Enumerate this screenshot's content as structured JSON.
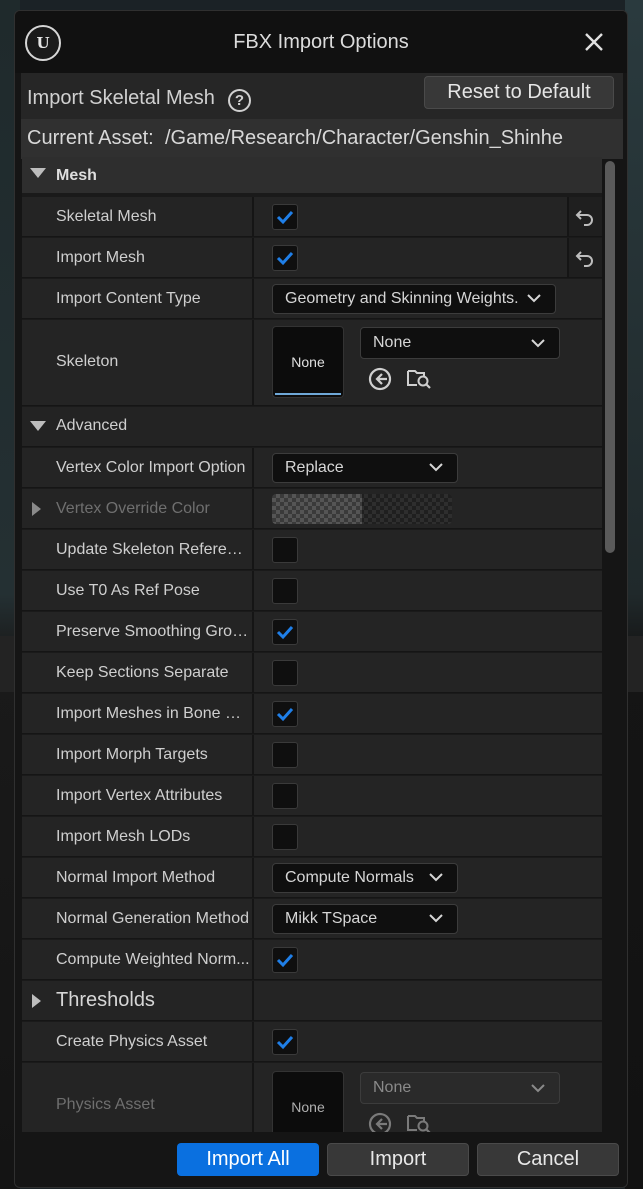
{
  "window": {
    "title": "FBX Import Options",
    "logo_text": "U"
  },
  "header": {
    "label": "Import Skeletal Mesh",
    "help_glyph": "?",
    "reset_label": "Reset to Default"
  },
  "asset": {
    "label": "Current Asset:",
    "path": "/Game/Research/Character/Genshin_Shinhe"
  },
  "categories": {
    "mesh": "Mesh",
    "advanced": "Advanced",
    "thresholds": "Thresholds"
  },
  "rows": {
    "skeletal_mesh": {
      "label": "Skeletal Mesh",
      "checked": true
    },
    "import_mesh": {
      "label": "Import Mesh",
      "checked": true
    },
    "import_content_type": {
      "label": "Import Content Type",
      "value": "Geometry and Skinning Weights."
    },
    "skeleton": {
      "label": "Skeleton",
      "thumb": "None",
      "value": "None"
    },
    "vertex_color_import_option": {
      "label": "Vertex Color Import Option",
      "value": "Replace"
    },
    "vertex_override_color": {
      "label": "Vertex Override Color"
    },
    "update_skeleton_reference": {
      "label": "Update Skeleton Referenc...",
      "checked": false
    },
    "use_t0_as_ref_pose": {
      "label": "Use T0 As Ref Pose",
      "checked": false
    },
    "preserve_smoothing_groups": {
      "label": "Preserve Smoothing Grou...",
      "checked": true
    },
    "keep_sections_separate": {
      "label": "Keep Sections Separate",
      "checked": false
    },
    "import_meshes_in_bone_hierarchy": {
      "label": "Import Meshes in Bone Hi...",
      "checked": true
    },
    "import_morph_targets": {
      "label": "Import Morph Targets",
      "checked": false
    },
    "import_vertex_attributes": {
      "label": "Import Vertex Attributes",
      "checked": false
    },
    "import_mesh_lods": {
      "label": "Import Mesh LODs",
      "checked": false
    },
    "normal_import_method": {
      "label": "Normal Import Method",
      "value": "Compute Normals"
    },
    "normal_generation_method": {
      "label": "Normal Generation Method",
      "value": "Mikk TSpace"
    },
    "compute_weighted_normals": {
      "label": "Compute Weighted Norm...",
      "checked": true
    },
    "create_physics_asset": {
      "label": "Create Physics Asset",
      "checked": true
    },
    "physics_asset": {
      "label": "Physics Asset",
      "thumb": "None",
      "value": "None"
    }
  },
  "footer": {
    "import_all": "Import All",
    "import": "Import",
    "cancel": "Cancel"
  },
  "colors": {
    "accent": "#0a70e0",
    "check": "#1f7fe8",
    "skeleton_underline": "#6fa8d8",
    "physics_underline": "#8a6a2a"
  }
}
